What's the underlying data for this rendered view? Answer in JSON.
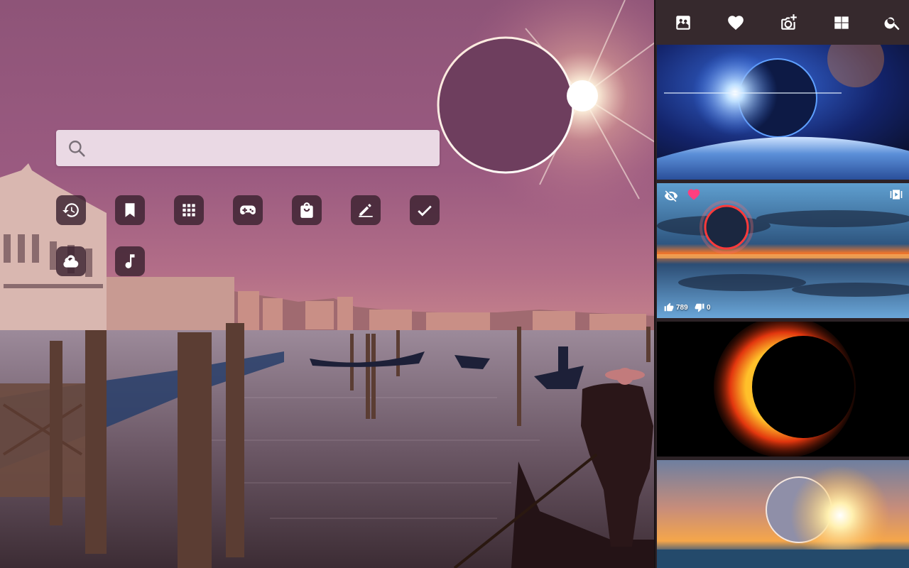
{
  "search": {
    "placeholder": "",
    "value": ""
  },
  "shortcuts": [
    {
      "name": "history-icon"
    },
    {
      "name": "bookmark-icon"
    },
    {
      "name": "apps-grid-icon"
    },
    {
      "name": "gamepad-icon"
    },
    {
      "name": "shopping-bag-icon"
    },
    {
      "name": "edit-icon"
    },
    {
      "name": "checkmark-icon"
    },
    {
      "name": "weather-icon"
    },
    {
      "name": "music-note-icon"
    }
  ],
  "toolbar": [
    {
      "name": "wallpaper-gallery-icon"
    },
    {
      "name": "favorites-heart-icon"
    },
    {
      "name": "add-photo-icon"
    },
    {
      "name": "windows-grid-icon"
    },
    {
      "name": "search-icon"
    }
  ],
  "wallpapers": [
    {
      "name": "space-eclipse-over-earth"
    },
    {
      "name": "ring-eclipse-over-sea",
      "likes": "789",
      "dislikes": "0"
    },
    {
      "name": "red-solar-eclipse"
    },
    {
      "name": "sunset-eclipse-over-ocean"
    }
  ],
  "colors": {
    "panel_bg": "#2c2226",
    "toolbar_bg": "#36292d",
    "heart_accent": "#ff3f7f",
    "tile_bg": "#3a2230"
  }
}
